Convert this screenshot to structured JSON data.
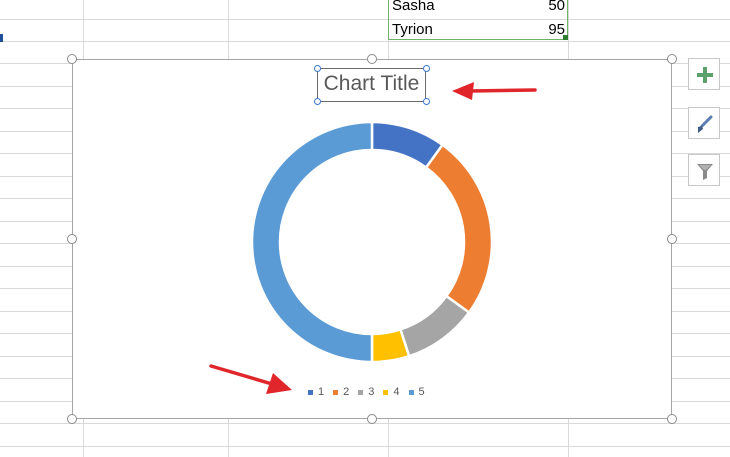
{
  "sheet": {
    "rows": [
      {
        "name": "Sasha",
        "value": "50"
      },
      {
        "name": "Tyrion",
        "value": "95"
      }
    ]
  },
  "chart": {
    "title": "Chart Title"
  },
  "chart_data": {
    "type": "pie",
    "style": "doughnut",
    "title": "Chart Title",
    "categories": [
      "1",
      "2",
      "3",
      "4",
      "5"
    ],
    "values": [
      10,
      25,
      10,
      5,
      50
    ],
    "colors": [
      "#4472c4",
      "#ed7d31",
      "#a5a5a5",
      "#ffc000",
      "#5b9bd5"
    ],
    "legend": "bottom"
  },
  "toolbar": {
    "elements_icon": "plus-icon",
    "styles_icon": "paintbrush-icon",
    "filters_icon": "funnel-icon"
  },
  "annotations": {
    "arrow_color": "#e0262b"
  }
}
